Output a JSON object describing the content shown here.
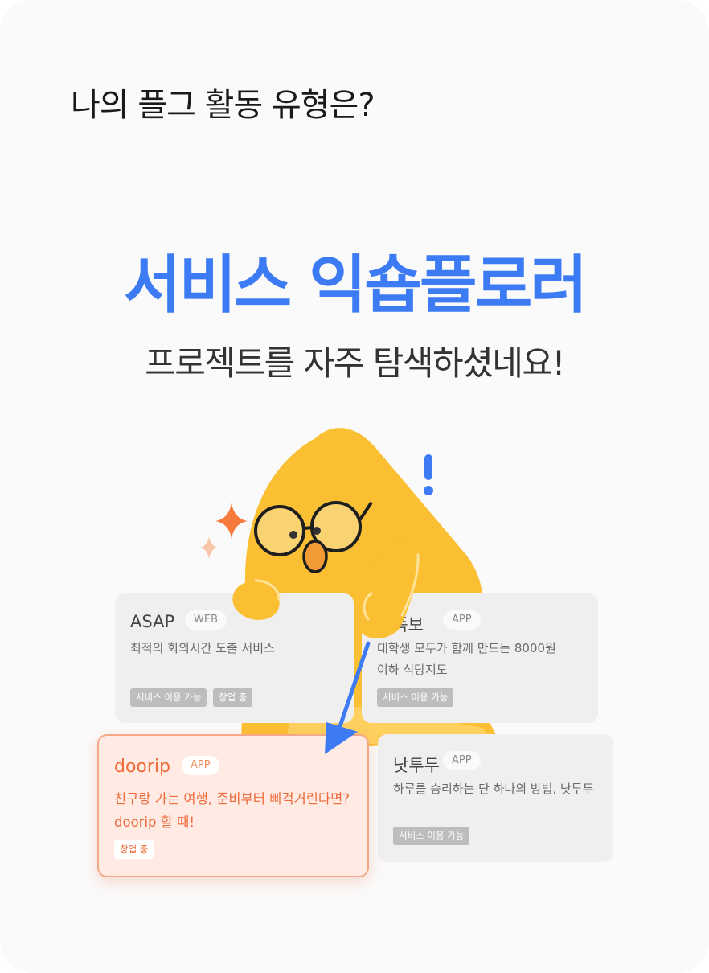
{
  "question": "나의 플그 활동 유형은?",
  "result": {
    "title": "서비스 익숍플로러",
    "subtitle": "프로젝트를 자주 탐색하셨네요!"
  },
  "colors": {
    "accent_blue": "#3d7bf4",
    "mascot_yellow": "#fbbf33",
    "highlight_orange": "#ee6a3a"
  },
  "projects": [
    {
      "name": "ASAP",
      "platform": "WEB",
      "description": [
        "최적의 회의시간 도출 서비스"
      ],
      "badges": [
        "서비스 이용 가능",
        "창업 중"
      ]
    },
    {
      "name": "밥족보",
      "platform": "APP",
      "description": [
        "대학생 모두가 함께 만드는 8000원",
        "이하 식당지도"
      ],
      "badges": [
        "서비스 이용 가능"
      ]
    },
    {
      "name": "doorip",
      "platform": "APP",
      "description": [
        "친구랑 가는 여행, 준비부터 삐걱거린다면?",
        "doorip 할 때!"
      ],
      "badges": [
        "창업 중"
      ],
      "highlighted": true
    },
    {
      "name": "낫투두",
      "platform": "APP",
      "description": [
        "하루를 승리하는 단 하나의 방법, 낫투두"
      ],
      "badges": [
        "서비스 이용 가능"
      ]
    }
  ],
  "illustration": {
    "mascot": "yellow-triangle-character-with-glasses",
    "exclamation": "!",
    "sparkles": [
      "sparkle-large",
      "sparkle-small"
    ],
    "pointer": "arrow-pointing-to-doorip-card"
  }
}
